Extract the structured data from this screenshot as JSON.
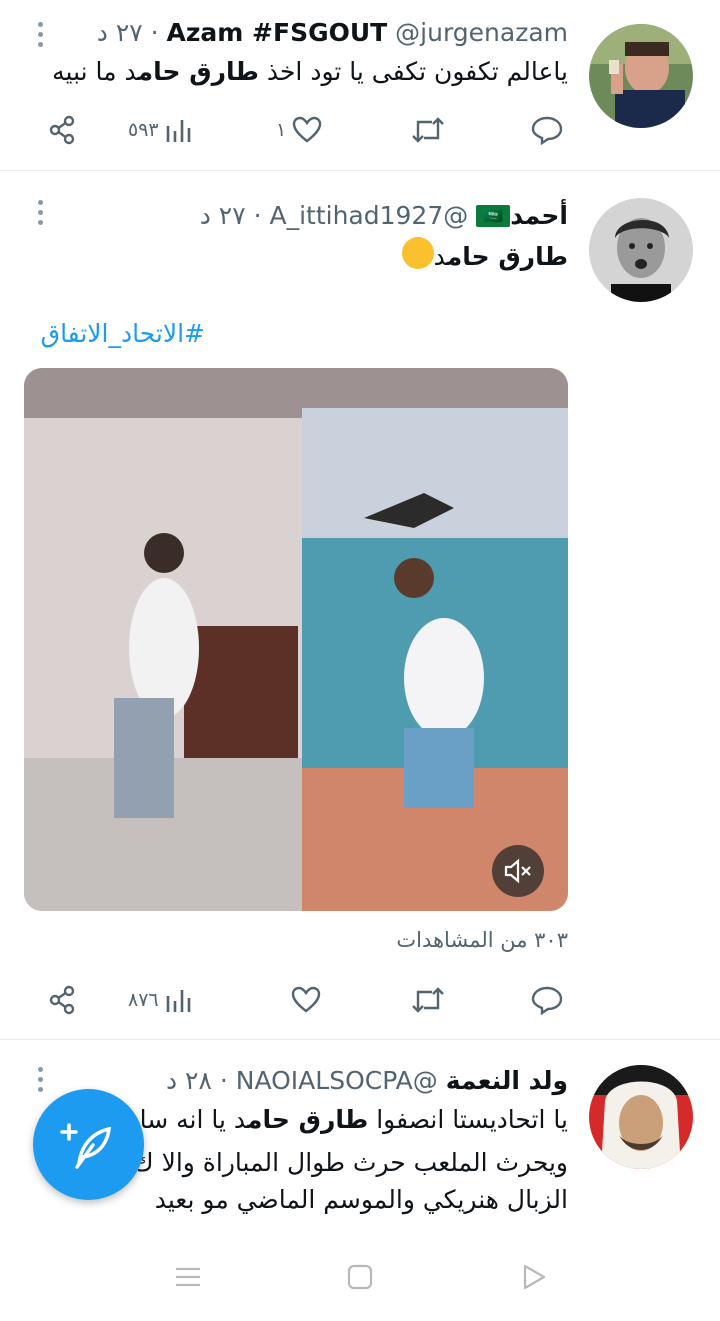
{
  "tweets": [
    {
      "name": "Azam #FSGOUT",
      "meta": "@jurgenazam · ٢٧ د",
      "text_parts": [
        "ياعالم تكفون تكفى يا تود اخذ ",
        "طارق حام",
        "د ما نبيه"
      ],
      "actions": {
        "reply": "",
        "retweet": "",
        "like": "١",
        "views": "٥٩٣"
      }
    },
    {
      "name": "أحمد",
      "flag": "🇸🇦",
      "meta": "@A_ittihad1927 · ٢٧ د",
      "text_parts": [
        "طارق حام",
        "د",
        "🙂"
      ],
      "hashtag": "#الاتحاد_الاتفاق",
      "views_caption": "٣٠٣ من المشاهدات",
      "actions": {
        "reply": "",
        "retweet": "",
        "like": "",
        "views": "٨٧٦"
      }
    },
    {
      "name": "ولد النعمة",
      "meta": "@NAOIALSOCPA · ٢٨ د",
      "lines": [
        [
          "يا اتحاديستا انصفوا ",
          "طارق حام",
          "د يا انه سا"
        ],
        [
          "ويحرث الملعب حرث طوال المباراة والا ك"
        ],
        [
          "الزبال هنريكي والموسم الماضي مو بعيد"
        ]
      ]
    }
  ],
  "icons": {
    "share": "share-icon",
    "views": "analytics-icon",
    "like": "heart-icon",
    "retweet": "retweet-icon",
    "reply": "reply-icon",
    "more": "more-vertical-icon",
    "mute": "muted-speaker-icon",
    "compose": "compose-tweet-icon",
    "nav_recent": "recent-apps-icon",
    "nav_home": "home-icon",
    "nav_back": "back-icon"
  },
  "colors": {
    "accent": "#1d9bf0",
    "muted": "#536471",
    "text": "#0f1419"
  }
}
